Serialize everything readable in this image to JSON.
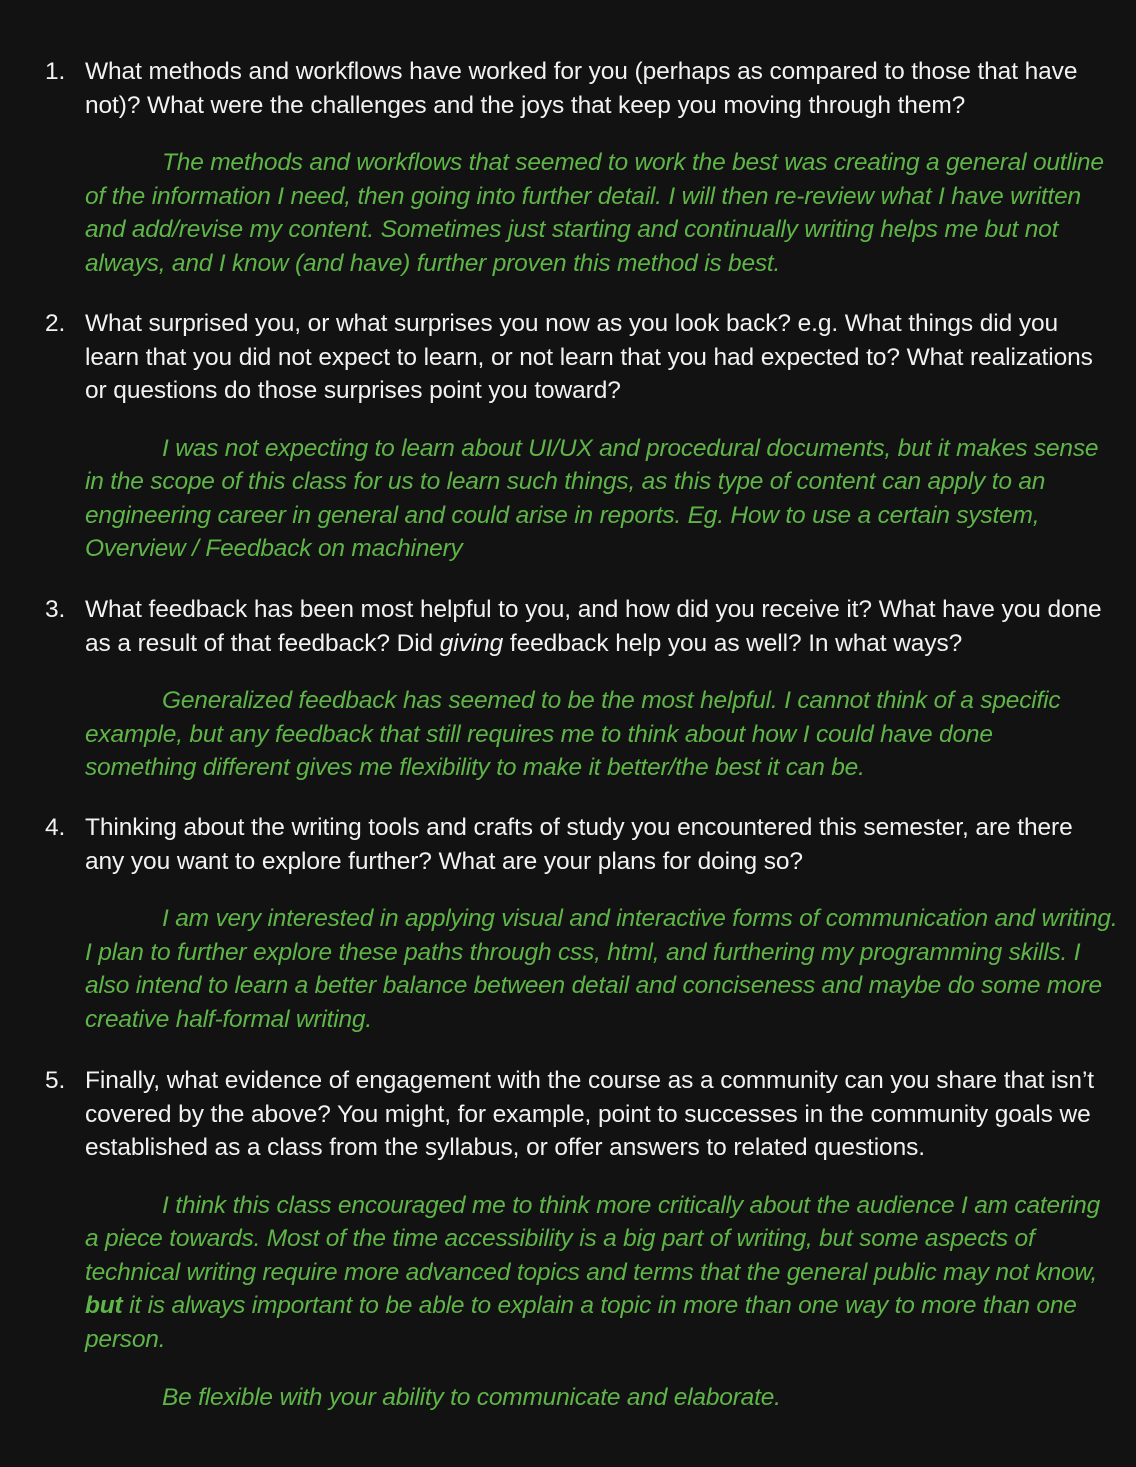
{
  "items": [
    {
      "number": "1.",
      "question": "What methods and workflows have worked for you (perhaps as compared to those that have not)? What were the challenges and the joys that keep you moving through them?",
      "answer": "The methods and workflows that seemed to work the best was creating a general outline of the information I need, then going into further detail. I will then re-review what I have written and add/revise my content. Sometimes just starting and continually writing helps me but not always, and I know (and have) further proven this method is best."
    },
    {
      "number": "2.",
      "question": "What surprised you, or what surprises you now as you look back? e.g. What things did you learn that you did not expect to learn, or not learn that you had expected to? What realizations or questions do those surprises point you toward?",
      "answer": "I was not expecting to learn about UI/UX and procedural documents, but it makes sense in the scope of this class for us to learn such things, as this type of content can apply to an engineering career in general and could arise in reports. Eg. How to use a certain system, Overview / Feedback on machinery"
    },
    {
      "number": "3.",
      "question_part1": "What feedback has been most helpful to you, and how did you receive it? What have you done as a result of that feedback? Did ",
      "question_italic": "giving",
      "question_part2": " feedback help you as well? In what ways?",
      "answer": "Generalized feedback has seemed to be the most helpful. I cannot think of a specific example, but any feedback that still requires me to think about how I could have done something different gives me flexibility to make it better/the best it can be."
    },
    {
      "number": "4.",
      "question": "Thinking about the writing tools and crafts of study you encountered this semester, are there any you want to explore further? What are your plans for doing so?",
      "answer": "I am very interested in applying visual and interactive forms of communication and writing. I plan to further explore these paths through css, html, and furthering my programming skills. I also intend to learn a better balance between detail and conciseness and maybe do some more creative half-formal writing."
    },
    {
      "number": "5.",
      "question": "Finally, what evidence of engagement with the course as a community can you share that isn’t covered by the above? You might, for example, point to successes in the community goals we established as a class from the syllabus, or offer answers to related questions.",
      "answer_part1": "I think this class encouraged me to think more critically about the audience I am catering a piece towards. Most of the time accessibility is a big part of writing, but some aspects of technical writing require more advanced topics and terms that the general public may not know, ",
      "answer_bold": "but",
      "answer_part2": " it is always important to be able to explain a topic in more than one way to more than one person.",
      "answer_extra": "Be flexible with your ability to communicate and elaborate."
    }
  ]
}
